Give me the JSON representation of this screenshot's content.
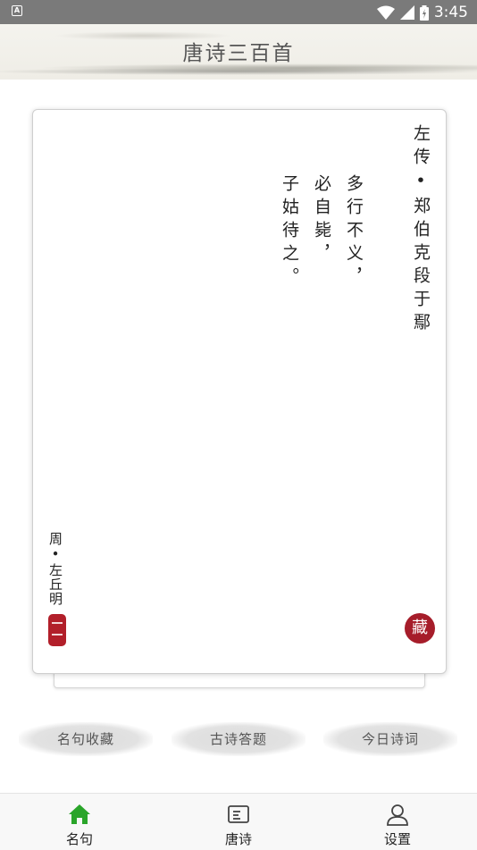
{
  "status_bar": {
    "time": "3:45",
    "left_icon": "A"
  },
  "header": {
    "title": "唐诗三百首"
  },
  "card": {
    "source": "左传•郑伯克段于鄢",
    "lines": [
      "多行不义，",
      "必自毙，",
      "子姑待之。"
    ],
    "author": "周•左丘明",
    "favorite_label": "藏",
    "favorite_color": "#a61d2a"
  },
  "actions": [
    "名句收藏",
    "古诗答题",
    "今日诗词"
  ],
  "nav": {
    "items": [
      {
        "label": "名句",
        "icon": "home-icon",
        "active": true
      },
      {
        "label": "唐诗",
        "icon": "article-icon",
        "active": false
      },
      {
        "label": "设置",
        "icon": "user-icon",
        "active": false
      }
    ],
    "active_color": "#2aa52a"
  }
}
